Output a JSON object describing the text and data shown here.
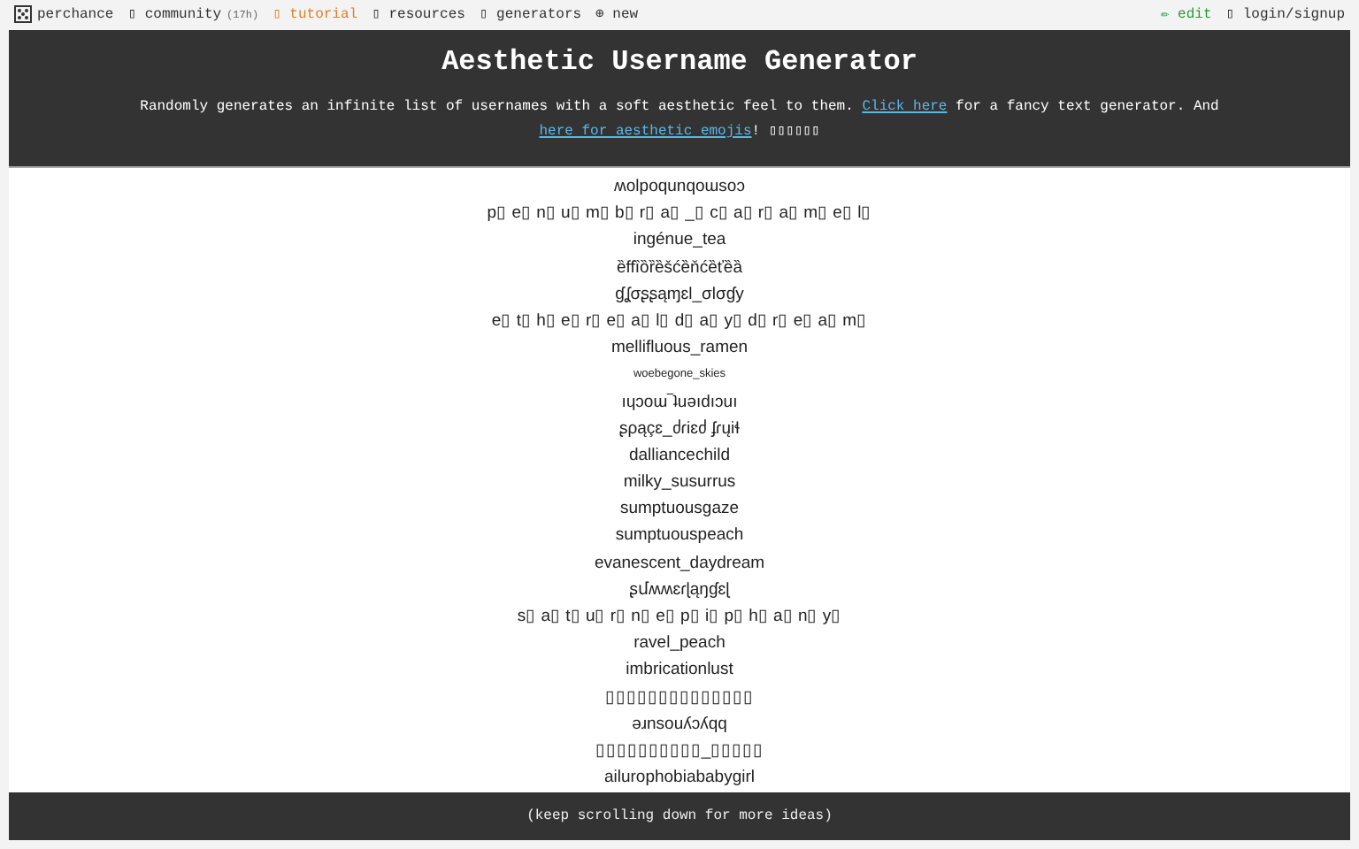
{
  "nav": {
    "left": [
      {
        "kind": "logo",
        "label": "perchance"
      },
      {
        "kind": "plain",
        "label": "▯ community",
        "note": "(17h)"
      },
      {
        "kind": "accent",
        "label": "▯ tutorial"
      },
      {
        "kind": "plain",
        "label": "▯ resources"
      },
      {
        "kind": "plain",
        "label": "▯ generators"
      },
      {
        "kind": "plain",
        "label": "⊕ new"
      }
    ],
    "right": [
      {
        "kind": "edit",
        "label": "✏ edit"
      },
      {
        "kind": "plain",
        "label": "▯ login/signup"
      }
    ]
  },
  "header": {
    "title": "Aesthetic Username Generator",
    "description": [
      "Randomly generates an infinite list of usernames with a soft aesthetic feel to them. ",
      "Click here",
      " for a fancy text generator. And ",
      "here for aesthetic emojis",
      "! ▯▯▯▯▯▯"
    ]
  },
  "usernames": [
    {
      "kind": "normal",
      "text": "ʍolpoqunqoɯsoɔ"
    },
    {
      "kind": "normal",
      "text": "p▯ e▯ n▯ u▯ m▯ b▯ r▯ a▯ _▯ c▯ a▯ r▯ a▯ m▯ e▯ l▯"
    },
    {
      "kind": "normal",
      "text": "ingénue_tea"
    },
    {
      "kind": "normal",
      "text": "ȅffȉȍȑȅšćȅňćȅťȅȁ"
    },
    {
      "kind": "normal",
      "text": "ɠʆσʂʂąɱɛl_σlσɠy"
    },
    {
      "kind": "normal",
      "text": "e▯ t▯ h▯ e▯ r▯ e▯ a▯ l▯ d▯ a▯ y▯ d▯ r▯ e▯ a▯ m▯"
    },
    {
      "kind": "normal",
      "text": "mellifluous_ramen"
    },
    {
      "kind": "small",
      "text": "woebegone_skies"
    },
    {
      "kind": "normal",
      "text": "ıɥɔoɯ‾ʇuǝıdıɔuı"
    },
    {
      "kind": "normal",
      "text": "ʂρąçɛ_ძɾiɛძ ʄɾųiɬ"
    },
    {
      "kind": "normal",
      "text": "dalliancechild"
    },
    {
      "kind": "normal",
      "text": "milky_susurrus"
    },
    {
      "kind": "normal",
      "text": "sumptuousgaze"
    },
    {
      "kind": "normal",
      "text": "sumptuouspeach"
    },
    {
      "kind": "normal",
      "text": "evanescent_daydream"
    },
    {
      "kind": "normal",
      "text": "ʂմʍʍɛɾɭąŋɠɛɭ"
    },
    {
      "kind": "normal",
      "text": "s▯ a▯ t▯ u▯ r▯ n▯ e▯ p▯ i▯ p▯ h▯ a▯ n▯ y▯"
    },
    {
      "kind": "normal",
      "text": "ravel_peach"
    },
    {
      "kind": "normal",
      "text": "imbricationlust"
    },
    {
      "kind": "normal",
      "text": "▯▯▯▯▯▯▯▯▯▯▯▯▯▯"
    },
    {
      "kind": "normal",
      "text": "ǝɹnsouʎɔʎqq"
    },
    {
      "kind": "normal",
      "text": "▯▯▯▯▯▯▯▯▯▯_▯▯▯▯▯"
    },
    {
      "kind": "normal",
      "text": "ailurophobiababygirl"
    }
  ],
  "footer": "(keep scrolling down for more ideas)"
}
